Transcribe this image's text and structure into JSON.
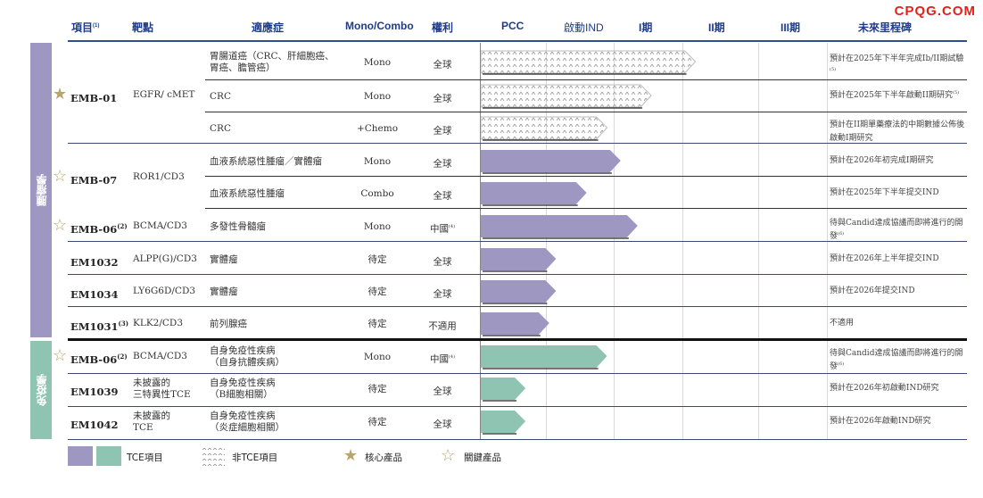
{
  "watermark": "CPQG.COM",
  "headers": {
    "item": "項目",
    "item_sup": "(1)",
    "target": "靶點",
    "indication": "適應症",
    "monocombo": "Mono/Combo",
    "rights": "權利",
    "pcc": "PCC",
    "ind": "啟動IND",
    "phase1": "I期",
    "phase2": "II期",
    "phase3": "III期",
    "milestone": "未來里程碑"
  },
  "sections": {
    "oncology": "腫瘤學",
    "immunology": "免疫學"
  },
  "colors": {
    "oncology": "#9d97c2",
    "immunology": "#8fc3b2",
    "core_star": "#b8a56d",
    "header_blue": "#1f3c8a"
  },
  "products": [
    {
      "name": "EMB-01",
      "sup": "",
      "target": "EGFR/ cMET",
      "star": "core"
    },
    {
      "name": "EMB-07",
      "sup": "",
      "target": "ROR1/CD3",
      "star": "key"
    },
    {
      "name": "EMB-06",
      "sup": "(2)",
      "target": "BCMA/CD3",
      "star": "key"
    },
    {
      "name": "EM1032",
      "sup": "",
      "target": "ALPP(G)/CD3",
      "star": ""
    },
    {
      "name": "EM1034",
      "sup": "",
      "target": "LY6G6D/CD3",
      "star": ""
    },
    {
      "name": "EM1031",
      "sup": "(3)",
      "target": "KLK2/CD3",
      "star": ""
    },
    {
      "name": "EMB-06",
      "sup": "(2)",
      "target": "BCMA/CD3",
      "star": "key"
    },
    {
      "name": "EM1039",
      "sup": "",
      "target": "未披露的\n三特異性TCE",
      "star": ""
    },
    {
      "name": "EM1042",
      "sup": "",
      "target": "未披露的\nTCE",
      "star": ""
    }
  ],
  "rows": [
    {
      "indication": "胃腸道癌（CRC、肝細胞癌、\n胃癌、膽管癌）",
      "mono": "Mono",
      "rights": "全球",
      "rights_sup": "",
      "progress": "I期-II期",
      "progress_value": 0.6,
      "bar": "hatch",
      "milestone": "預計在2025年下半年完成Ib/II期試驗",
      "milestone_sup": "(5)"
    },
    {
      "indication": "CRC",
      "mono": "Mono",
      "rights": "全球",
      "rights_sup": "",
      "progress": "II期",
      "progress_value": 0.47,
      "bar": "hatch",
      "milestone": "預計在2025年下半年啟動II期研究",
      "milestone_sup": "(5)"
    },
    {
      "indication": "CRC",
      "mono": "+Chemo",
      "rights": "全球",
      "rights_sup": "",
      "progress": "I期",
      "progress_value": 0.34,
      "bar": "hatch",
      "milestone": "預計在II期單藥療法的中期數據公佈後啟動I期研究",
      "milestone_sup": ""
    },
    {
      "indication": "血液系統惡性腫瘤／實體瘤",
      "mono": "Mono",
      "rights": "全球",
      "rights_sup": "",
      "progress": "I期",
      "progress_value": 0.38,
      "bar": "onc",
      "milestone": "預計在2026年初完成I期研究",
      "milestone_sup": ""
    },
    {
      "indication": "血液系統惡性腫瘤",
      "mono": "Combo",
      "rights": "全球",
      "rights_sup": "",
      "progress": "啟動IND",
      "progress_value": 0.28,
      "bar": "onc",
      "milestone": "預計在2025年下半年提交IND",
      "milestone_sup": ""
    },
    {
      "indication": "多發性骨髓瘤",
      "mono": "Mono",
      "rights": "中國",
      "rights_sup": "(4)",
      "progress": "I期",
      "progress_value": 0.43,
      "bar": "onc",
      "milestone": "待與Candid達成協議而即將進行的開發",
      "milestone_sup": "(6)"
    },
    {
      "indication": "實體瘤",
      "mono": "待定",
      "rights": "全球",
      "rights_sup": "",
      "progress": "PCC",
      "progress_value": 0.19,
      "bar": "onc",
      "milestone": "預計在2026年上半年提交IND",
      "milestone_sup": ""
    },
    {
      "indication": "實體瘤",
      "mono": "待定",
      "rights": "全球",
      "rights_sup": "",
      "progress": "PCC",
      "progress_value": 0.19,
      "bar": "onc",
      "milestone": "預計在2026年提交IND",
      "milestone_sup": ""
    },
    {
      "indication": "前列腺癌",
      "mono": "待定",
      "rights": "不適用",
      "rights_sup": "",
      "progress": "PCC",
      "progress_value": 0.17,
      "bar": "onc",
      "milestone": "不適用",
      "milestone_sup": ""
    },
    {
      "indication": "自身免疫性疾病\n（自身抗體疾病）",
      "mono": "Mono",
      "rights": "中國",
      "rights_sup": "(4)",
      "progress": "I期",
      "progress_value": 0.34,
      "bar": "imm",
      "milestone": "待與Candid達成協議而即將進行的開發",
      "milestone_sup": "(6)"
    },
    {
      "indication": "自身免疫性疾病\n（B細胞相關）",
      "mono": "待定",
      "rights": "全球",
      "rights_sup": "",
      "progress": "PCC",
      "progress_value": 0.1,
      "bar": "imm",
      "milestone": "預計在2026年初啟動IND研究",
      "milestone_sup": ""
    },
    {
      "indication": "自身免疫性疾病\n（炎症細胞相關）",
      "mono": "待定",
      "rights": "全球",
      "rights_sup": "",
      "progress": "PCC",
      "progress_value": 0.1,
      "bar": "imm",
      "milestone": "預計在2026年啟動IND研究",
      "milestone_sup": ""
    }
  ],
  "legend": {
    "tce": "TCE項目",
    "non_tce": "非TCE項目",
    "core": "核心產品",
    "key": "關鍵產品"
  }
}
